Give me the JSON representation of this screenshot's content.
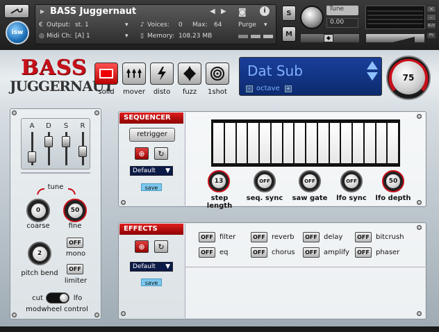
{
  "header": {
    "instrument_name": "BASS Juggernaut",
    "output_label": "Output:",
    "output_value": "st. 1",
    "midi_label": "Midi Ch:",
    "midi_value": "[A] 1",
    "voices_label": "Voices:",
    "voices_value": "0",
    "max_label": "Max:",
    "max_value": "64",
    "memory_label": "Memory:",
    "memory_value": "108.23 MB",
    "purge_label": "Purge",
    "solo_label": "S",
    "mute_label": "M",
    "tune_label": "Tune",
    "tune_value": "0.00",
    "aux_label": "AUX",
    "pv_label": "PV",
    "logo_text": "isw"
  },
  "brand": {
    "line1": "BASS",
    "line2": "JUGGERNAUT"
  },
  "modes": [
    {
      "label": "solid",
      "icon": "solid-icon",
      "active": true
    },
    {
      "label": "mover",
      "icon": "mover-icon",
      "active": false
    },
    {
      "label": "disto",
      "icon": "lightning-icon",
      "active": false
    },
    {
      "label": "fuzz",
      "icon": "fuzz-icon",
      "active": false
    },
    {
      "label": "1shot",
      "icon": "target-icon",
      "active": false
    }
  ],
  "preset": {
    "name": "Dat Sub",
    "octave_label": "octave",
    "minus": "-",
    "plus": "+"
  },
  "volume_knob": {
    "value": "75"
  },
  "envelope": {
    "labels": [
      "A",
      "D",
      "S",
      "R"
    ]
  },
  "tune": {
    "title": "tune",
    "coarse_label": "coarse",
    "coarse_value": "0",
    "fine_label": "fine",
    "fine_value": "50"
  },
  "pitch_bend": {
    "label": "pitch bend",
    "value": "2"
  },
  "mono": {
    "button": "OFF",
    "label": "mono"
  },
  "limiter": {
    "button": "OFF",
    "label": "limiter"
  },
  "modwheel": {
    "left": "cut",
    "right": "lfo",
    "label": "modwheel control"
  },
  "sequencer": {
    "title": "SEQUENCER",
    "retrigger": "retrigger",
    "preset": "Default",
    "save": "save",
    "knobs": [
      {
        "label": "step length",
        "value": "13"
      },
      {
        "label": "seq. sync",
        "value": "OFF"
      },
      {
        "label": "saw gate",
        "value": "OFF"
      },
      {
        "label": "lfo sync",
        "value": "OFF"
      },
      {
        "label": "lfo depth",
        "value": "50"
      }
    ]
  },
  "effects": {
    "title": "EFFECTS",
    "preset": "Default",
    "save": "save",
    "items": [
      {
        "button": "OFF",
        "label": "filter"
      },
      {
        "button": "OFF",
        "label": "reverb"
      },
      {
        "button": "OFF",
        "label": "delay"
      },
      {
        "button": "OFF",
        "label": "bitcrush"
      },
      {
        "button": "OFF",
        "label": "eq"
      },
      {
        "button": "OFF",
        "label": "chorus"
      },
      {
        "button": "OFF",
        "label": "amplify"
      },
      {
        "button": "OFF",
        "label": "phaser"
      }
    ]
  },
  "colors": {
    "accent_red": "#c8101a",
    "preset_blue": "#0c2a6e",
    "save_blue": "#7cc8ee"
  }
}
